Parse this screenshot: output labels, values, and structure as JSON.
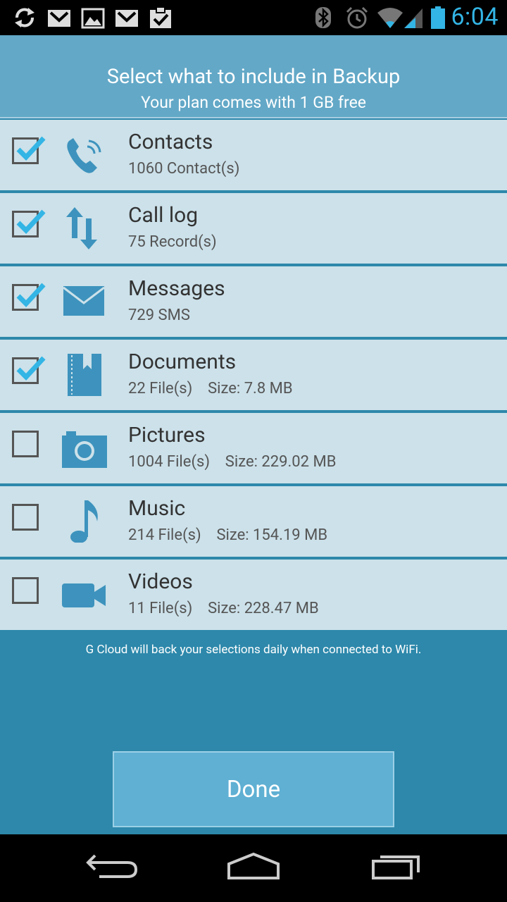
{
  "status_bar": {
    "time": "6:04",
    "icons": [
      "sync-icon",
      "gmail-icon",
      "image-icon",
      "gmail-icon",
      "clipboard-check-icon",
      "bluetooth-icon",
      "alarm-icon",
      "wifi-icon",
      "signal-icon",
      "battery-icon"
    ]
  },
  "header": {
    "title": "Select what to include in Backup",
    "subtitle": "Your plan comes with 1 GB free"
  },
  "items": [
    {
      "label": "Contacts",
      "detail": "1060 Contact(s)",
      "checked": true,
      "icon": "phone-icon"
    },
    {
      "label": "Call log",
      "detail": "75 Record(s)",
      "checked": true,
      "icon": "up-down-arrows-icon"
    },
    {
      "label": "Messages",
      "detail": "729 SMS",
      "checked": true,
      "icon": "envelope-icon"
    },
    {
      "label": "Documents",
      "detail": "22 File(s)    Size: 7.8 MB",
      "checked": true,
      "icon": "notebook-icon"
    },
    {
      "label": "Pictures",
      "detail": "1004 File(s)    Size: 229.02 MB",
      "checked": false,
      "icon": "camera-icon"
    },
    {
      "label": "Music",
      "detail": "214 File(s)    Size: 154.19 MB",
      "checked": false,
      "icon": "music-note-icon"
    },
    {
      "label": "Videos",
      "detail": "11 File(s)    Size: 228.47 MB",
      "checked": false,
      "icon": "video-camera-icon"
    }
  ],
  "footer_note": "G Cloud will back your selections daily when connected to WiFi.",
  "done_label": "Done",
  "colors": {
    "accent": "#33b5e5",
    "header": "#63a8c7",
    "background": "#2d88ab",
    "row": "#cce1ea",
    "icon": "#3d93bd",
    "button": "#5fb0d3"
  },
  "nav": [
    "back-icon",
    "home-icon",
    "recent-apps-icon"
  ]
}
